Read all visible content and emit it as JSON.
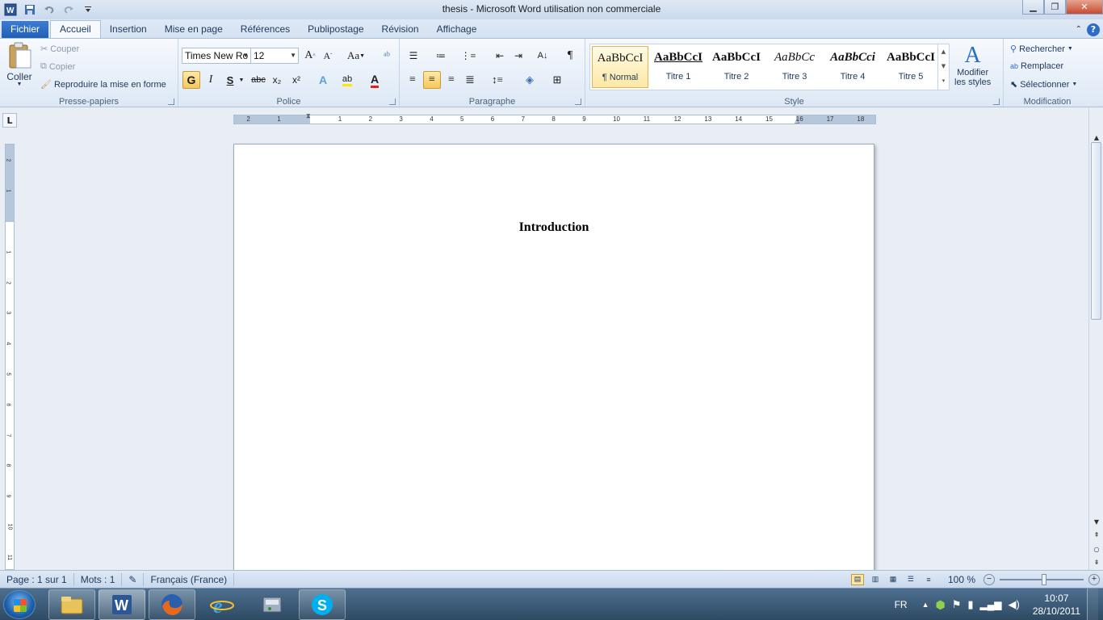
{
  "window": {
    "title": "thesis  -  Microsoft Word utilisation non commerciale"
  },
  "tabs": [
    "Fichier",
    "Accueil",
    "Insertion",
    "Mise en page",
    "Références",
    "Publipostage",
    "Révision",
    "Affichage"
  ],
  "clipboard": {
    "paste": "Coller",
    "cut": "Couper",
    "copy": "Copier",
    "format_painter": "Reproduire la mise en forme",
    "label": "Presse-papiers"
  },
  "font": {
    "name": "Times New Ro",
    "size": "12",
    "label": "Police",
    "bold": "G",
    "italic": "I",
    "underline": "S",
    "strikethrough": "abc",
    "subscript": "x₂",
    "superscript": "x²",
    "grow": "A",
    "shrink": "A",
    "case": "Aa"
  },
  "paragraph": {
    "label": "Paragraphe"
  },
  "styles": {
    "label": "Style",
    "items": [
      {
        "preview": "AaBbCcI",
        "name": "¶ Normal"
      },
      {
        "preview": "AaBbCcI",
        "name": "Titre 1"
      },
      {
        "preview": "AaBbCcI",
        "name": "Titre 2"
      },
      {
        "preview": "AaBbCc",
        "name": "Titre 3"
      },
      {
        "preview": "AaBbCci",
        "name": "Titre 4"
      },
      {
        "preview": "AaBbCcI",
        "name": "Titre 5"
      }
    ],
    "modify_line1": "Modifier",
    "modify_line2": "les styles"
  },
  "editing": {
    "label": "Modification",
    "find": "Rechercher",
    "replace": "Remplacer",
    "select": "Sélectionner"
  },
  "ruler": {
    "h_ticks": [
      "2",
      "1",
      "1",
      "2",
      "3",
      "4",
      "5",
      "6",
      "7",
      "8",
      "9",
      "10",
      "11",
      "12",
      "13",
      "14",
      "15",
      "16",
      "17",
      "18"
    ],
    "v_ticks": [
      "2",
      "1",
      "1",
      "2",
      "3",
      "4",
      "5",
      "6",
      "7",
      "8",
      "9",
      "10",
      "11"
    ]
  },
  "document": {
    "heading": "Introduction"
  },
  "status": {
    "page": "Page : 1 sur 1",
    "words": "Mots : 1",
    "language": "Français (France)",
    "zoom": "100 %"
  },
  "taskbar": {
    "lang": "FR",
    "time": "10:07",
    "date": "28/10/2011"
  },
  "colors": {
    "accent": "#1f5fb6",
    "highlight": "#f7c85a"
  }
}
